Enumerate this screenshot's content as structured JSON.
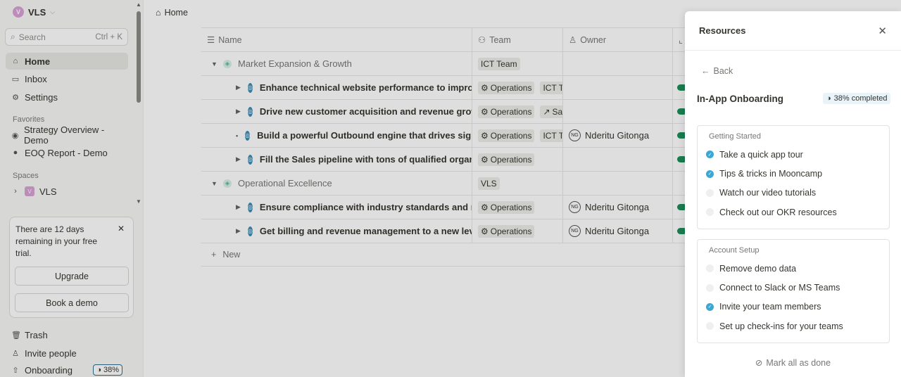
{
  "sidebar": {
    "workspace": {
      "initial": "V",
      "name": "VLS"
    },
    "search": {
      "label": "Search",
      "shortcut": "Ctrl + K"
    },
    "nav": [
      {
        "label": "Home",
        "icon": "home-icon"
      },
      {
        "label": "Inbox",
        "icon": "inbox-icon"
      },
      {
        "label": "Settings",
        "icon": "gear-icon"
      }
    ],
    "favorites_label": "Favorites",
    "favorites": [
      {
        "label": "Strategy Overview - Demo",
        "icon": "eye-icon"
      },
      {
        "label": "EOQ Report - Demo",
        "icon": "dollar-icon"
      }
    ],
    "spaces_label": "Spaces",
    "spaces": [
      {
        "initial": "V",
        "label": "VLS"
      }
    ],
    "trial": {
      "text": "There are 12 days remaining in your free trial.",
      "upgrade": "Upgrade",
      "demo": "Book a demo"
    },
    "bottom": [
      {
        "label": "Trash",
        "icon": "trash-icon"
      },
      {
        "label": "Invite people",
        "icon": "invite-icon"
      },
      {
        "label": "Onboarding",
        "icon": "rocket-icon",
        "badge": "38%"
      }
    ]
  },
  "breadcrumb": {
    "label": "Home"
  },
  "table": {
    "columns": {
      "name": "Name",
      "team": "Team",
      "owner": "Owner"
    },
    "groups": [
      {
        "name": "Market Expansion & Growth",
        "team": "ICT Team",
        "goals": [
          {
            "name": "Enhance technical website performance to improve ...",
            "teams": [
              "Operations",
              "ICT Te"
            ],
            "owner": "",
            "bullet": false
          },
          {
            "name": "Drive new customer acquisition and revenue growt...",
            "teams": [
              "Operations",
              "Sal"
            ],
            "owner": "",
            "bullet": false
          },
          {
            "name": "Build a powerful Outbound engine that drives signi...",
            "teams": [
              "Operations",
              "ICT Te"
            ],
            "owner": "Nderitu Gitonga",
            "bullet": true
          },
          {
            "name": "Fill the Sales pipeline with tons of qualified organic ...",
            "teams": [
              "Operations"
            ],
            "owner": "",
            "bullet": false
          }
        ]
      },
      {
        "name": "Operational Excellence",
        "team": "VLS",
        "goals": [
          {
            "name": "Ensure compliance with industry standards and reg...",
            "teams": [
              "Operations"
            ],
            "owner": "Nderitu Gitonga",
            "bullet": false
          },
          {
            "name": "Get billing and revenue management to a new level",
            "teams": [
              "Operations"
            ],
            "owner": "Nderitu Gitonga",
            "bullet": false
          }
        ]
      }
    ],
    "owner_initials": "NG",
    "new_label": "New"
  },
  "panel": {
    "title": "Resources",
    "back": "Back",
    "onboarding_title": "In-App Onboarding",
    "completed": "38% completed",
    "sections": [
      {
        "label": "Getting Started",
        "items": [
          {
            "label": "Take a quick app tour",
            "done": true
          },
          {
            "label": "Tips & tricks in Mooncamp",
            "done": true
          },
          {
            "label": "Watch our video tutorials",
            "done": false
          },
          {
            "label": "Check out our OKR resources",
            "done": false
          }
        ]
      },
      {
        "label": "Account Setup",
        "items": [
          {
            "label": "Remove demo data",
            "done": false
          },
          {
            "label": "Connect to Slack or MS Teams",
            "done": false
          },
          {
            "label": "Invite your team members",
            "done": true
          },
          {
            "label": "Set up check-ins for your teams",
            "done": false
          }
        ]
      }
    ],
    "mark_all": "Mark all as done"
  },
  "colors": {
    "accent": "#3aa7d4",
    "progress": "#1d8f5a",
    "workspace": "#d9a2d6"
  }
}
